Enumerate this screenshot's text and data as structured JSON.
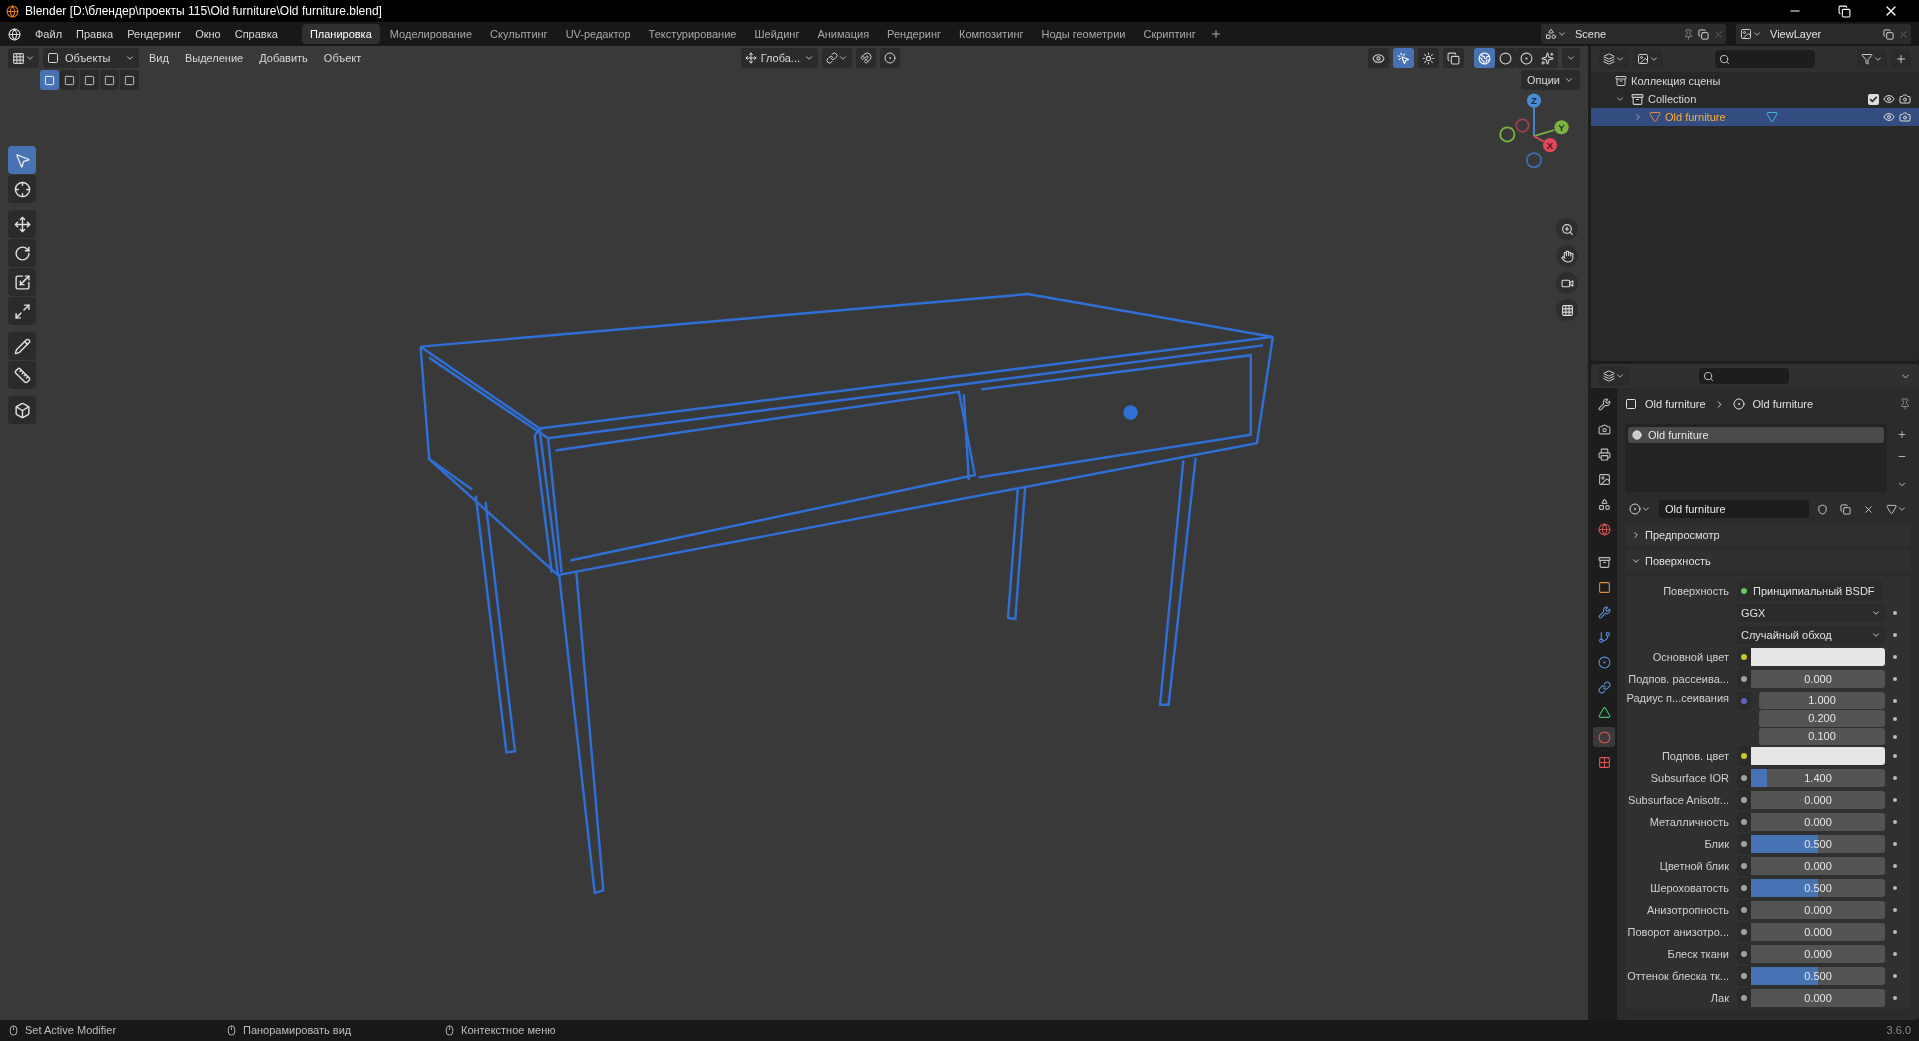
{
  "window": {
    "title": "Blender [D:\\блендер\\проекты 115\\Old furniture\\Old furniture.blend]"
  },
  "menu": [
    "Файл",
    "Правка",
    "Рендеринг",
    "Окно",
    "Справка"
  ],
  "workspaces": [
    {
      "label": "Планировка",
      "selected": true
    },
    {
      "label": "Моделирование",
      "selected": false
    },
    {
      "label": "Скульптинг",
      "selected": false
    },
    {
      "label": "UV-редактор",
      "selected": false
    },
    {
      "label": "Текстурирование",
      "selected": false
    },
    {
      "label": "Шейдинг",
      "selected": false
    },
    {
      "label": "Анимация",
      "selected": false
    },
    {
      "label": "Рендеринг",
      "selected": false
    },
    {
      "label": "Композитинг",
      "selected": false
    },
    {
      "label": "Ноды геометрии",
      "selected": false
    },
    {
      "label": "Скриптинг",
      "selected": false
    }
  ],
  "scene": "Scene",
  "view_layer": "ViewLayer",
  "viewport": {
    "mode": "Объекты",
    "menu": [
      "Вид",
      "Выделение",
      "Добавить",
      "Объект"
    ],
    "orientation": "Глоба...",
    "options": "Опции",
    "select_modes": [
      {
        "selected": true
      },
      {
        "selected": false
      },
      {
        "selected": false
      },
      {
        "selected": false
      },
      {
        "selected": false
      }
    ],
    "toggles": [
      {
        "on": false
      },
      {
        "on": true
      },
      {
        "on": false
      },
      {
        "on": false
      }
    ],
    "shading": [
      {
        "selected": true
      },
      {
        "selected": false
      },
      {
        "selected": false
      },
      {
        "selected": false
      }
    ],
    "tools": [
      {
        "selected": true
      },
      {
        "selected": false
      },
      {
        "selected": false
      },
      {
        "selected": false
      },
      {
        "selected": false
      },
      {
        "selected": false
      },
      {
        "selected": false
      },
      {
        "selected": false
      },
      {
        "selected": false
      }
    ],
    "axes": [
      "Z",
      "Y",
      "X"
    ]
  },
  "outliner": {
    "root": "Коллекция сцены",
    "children": [
      {
        "label": "Collection",
        "expanded": true,
        "checked": true,
        "selected": false,
        "children": [
          {
            "label": "Old furniture",
            "expanded": false,
            "selected": true
          }
        ]
      }
    ]
  },
  "properties": {
    "tabs": [
      {
        "selected": false
      },
      {
        "selected": false
      },
      {
        "selected": false
      },
      {
        "selected": false
      },
      {
        "selected": false
      },
      {
        "selected": false
      },
      {
        "selected": false
      },
      {
        "selected": false
      },
      {
        "selected": false
      },
      {
        "selected": false
      },
      {
        "selected": false
      },
      {
        "selected": false
      },
      {
        "selected": false
      },
      {
        "selected": true
      },
      {
        "selected": false
      }
    ],
    "breadcrumb": [
      "Old furniture",
      "Old furniture"
    ],
    "slots": [
      {
        "label": "Old furniture",
        "selected": true
      }
    ],
    "material": "Old furniture",
    "panels": [
      {
        "label": "Предпросмотр",
        "expanded": false
      },
      {
        "label": "Поверхность",
        "expanded": true
      }
    ],
    "rows": [
      {
        "kind": "shader",
        "label": "Поверхность",
        "value": "Принципиальный BSDF",
        "color": "#63c763"
      },
      {
        "kind": "dropdown",
        "value": "GGX"
      },
      {
        "kind": "dropdown",
        "value": "Случайный обход"
      },
      {
        "kind": "color",
        "label": "Основной цвет",
        "color": "#c7c729"
      },
      {
        "kind": "number",
        "label": "Подпов. рассеива...",
        "value": "0.000",
        "level": 0,
        "color": "#a1a1a1"
      },
      {
        "kind": "vector",
        "label": "Радиус п...сеивания",
        "values": [
          "1.000",
          "0.200",
          "0.100"
        ],
        "color": "#6363c7"
      },
      {
        "kind": "color",
        "label": "Подпов. цвет",
        "color": "#c7c729"
      },
      {
        "kind": "number",
        "label": "Subsurface IOR",
        "value": "1.400",
        "level": 0.12,
        "color": "#a1a1a1"
      },
      {
        "kind": "number",
        "label": "Subsurface Anisotr...",
        "value": "0.000",
        "level": 0,
        "color": "#a1a1a1"
      },
      {
        "kind": "number",
        "label": "Металличность",
        "value": "0.000",
        "level": 0,
        "color": "#a1a1a1"
      },
      {
        "kind": "number",
        "label": "Блик",
        "value": "0.500",
        "level": 0.5,
        "color": "#a1a1a1"
      },
      {
        "kind": "number",
        "label": "Цветной блик",
        "value": "0.000",
        "level": 0,
        "color": "#a1a1a1"
      },
      {
        "kind": "number",
        "label": "Шероховатость",
        "value": "0.500",
        "level": 0.5,
        "color": "#a1a1a1"
      },
      {
        "kind": "number",
        "label": "Анизотропность",
        "value": "0.000",
        "level": 0,
        "color": "#a1a1a1"
      },
      {
        "kind": "number",
        "label": "Поворот анизотро...",
        "value": "0.000",
        "level": 0,
        "color": "#a1a1a1"
      },
      {
        "kind": "number",
        "label": "Блеск ткани",
        "value": "0.000",
        "level": 0,
        "color": "#a1a1a1"
      },
      {
        "kind": "number",
        "label": "Оттенок блеска тк...",
        "value": "0.500",
        "level": 0.5,
        "color": "#a1a1a1"
      },
      {
        "kind": "number",
        "label": "Лак",
        "value": "0.000",
        "level": 0,
        "color": "#a1a1a1"
      }
    ]
  },
  "status_bar": {
    "hints": [
      "Set Active Modifier",
      "Панорамировать вид",
      "Контекстное меню"
    ],
    "version": "3.6.0"
  }
}
